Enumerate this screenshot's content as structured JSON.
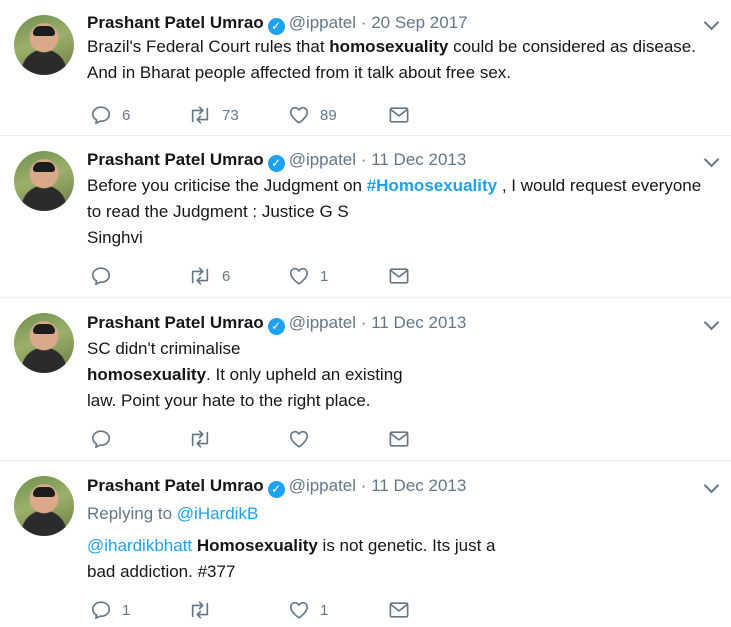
{
  "tweets": [
    {
      "name": "Prashant Patel Umrao",
      "handle": "@ippatel",
      "date": "20 Sep 2017",
      "text_parts": [
        "Brazil's Federal Court rules that ",
        "homosexuality",
        " could be considered as disease.",
        "And in Bharat people affected from it talk about free sex."
      ],
      "replies": "6",
      "retweets": "73",
      "likes": "89"
    },
    {
      "name": "Prashant Patel Umrao",
      "handle": "@ippatel",
      "date": "11 Dec 2013",
      "text_parts": [
        "Before you criticise the Judgment on ",
        "#Homosexuality",
        " , I would request everyone",
        "to read the Judgment : Justice G S",
        "Singhvi"
      ],
      "replies": "",
      "retweets": "6",
      "likes": "1"
    },
    {
      "name": "Prashant Patel Umrao",
      "handle": "@ippatel",
      "date": "11 Dec 2013",
      "text_parts": [
        "SC didn't criminalise",
        "homosexuality",
        ". It only upheld an existing",
        "law. Point your hate to the right place."
      ],
      "replies": "",
      "retweets": "",
      "likes": ""
    },
    {
      "name": "Prashant Patel Umrao",
      "handle": "@ippatel",
      "date": "11 Dec 2013",
      "replying_label": "Replying to ",
      "replying_to": "@iHardikB",
      "text_parts": [
        "@ihardikbhatt",
        " ",
        "Homosexuality",
        " is not genetic. Its just a",
        "bad addiction. #377"
      ],
      "replies": "1",
      "retweets": "",
      "likes": "1"
    }
  ],
  "separator": "·",
  "verified_glyph": "✓",
  "colors": {
    "link": "#1da1f2",
    "muted": "#657786",
    "text": "#14171a",
    "divider": "#e6ecf0"
  },
  "icons": [
    "reply-icon",
    "retweet-icon",
    "like-icon",
    "direct-message-icon",
    "verified-icon",
    "chevron-down-icon"
  ]
}
